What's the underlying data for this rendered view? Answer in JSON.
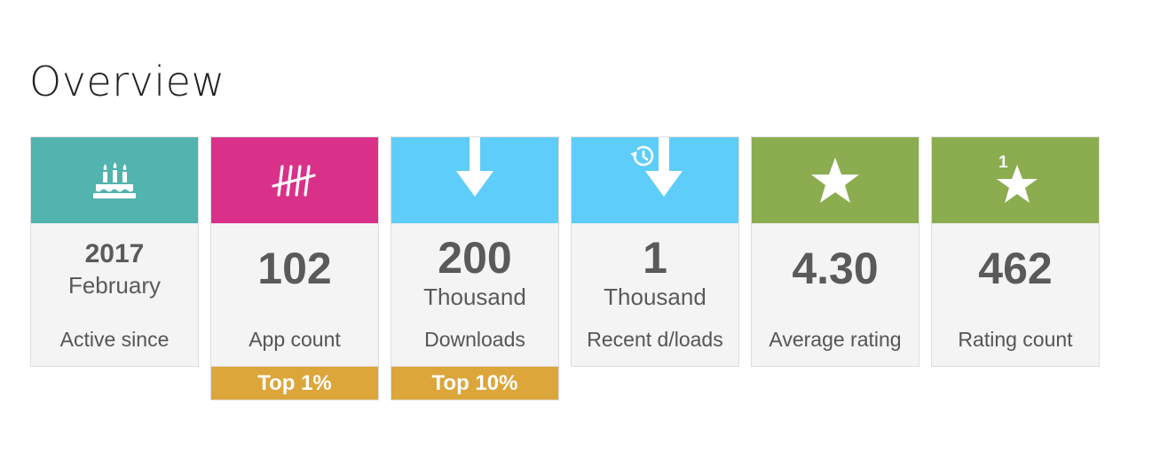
{
  "header": {
    "title": "Overview"
  },
  "colors": {
    "teal": "#52b3af",
    "magenta": "#d9318a",
    "sky": "#5ecdfa",
    "green": "#8bad50",
    "gold": "#dca63b",
    "card_bg": "#f4f4f4",
    "text": "#5a5a5a"
  },
  "cards": [
    {
      "icon": "birthday-cake-icon",
      "value": "2017",
      "unit": "February",
      "label": "Active since"
    },
    {
      "icon": "tally-marks-icon",
      "value": "102",
      "unit": "",
      "label": "App count",
      "badge": "Top 1%"
    },
    {
      "icon": "download-arrow-icon",
      "value": "200",
      "unit": "Thousand",
      "label": "Downloads",
      "badge": "Top 10%"
    },
    {
      "icon": "recent-download-icon",
      "value": "1",
      "unit": "Thousand",
      "label": "Recent d/loads"
    },
    {
      "icon": "star-icon",
      "value": "4.30",
      "unit": "",
      "label": "Average rating"
    },
    {
      "icon": "star-count-icon",
      "value": "462",
      "unit": "",
      "label": "Rating count"
    }
  ]
}
